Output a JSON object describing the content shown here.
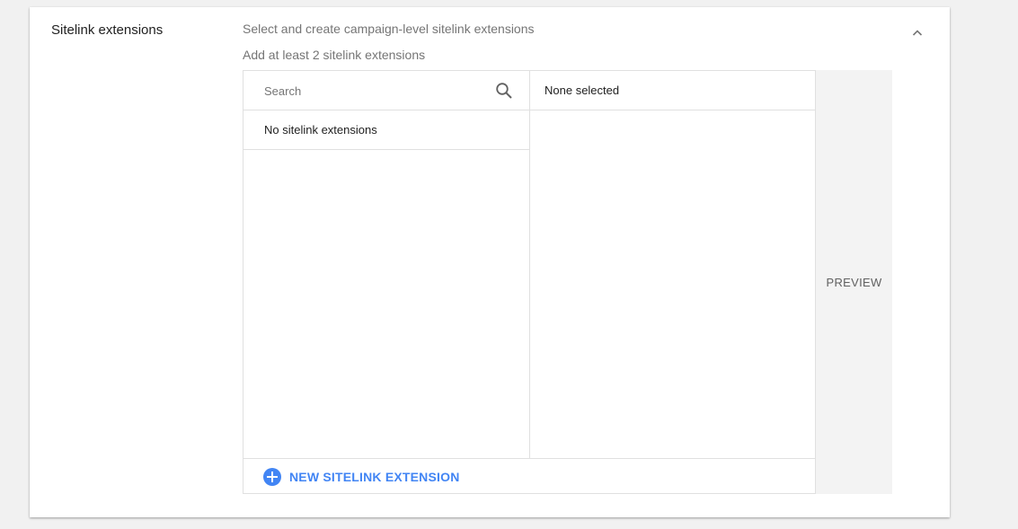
{
  "section": {
    "title": "Sitelink extensions",
    "subtitle": "Select and create campaign-level sitelink extensions",
    "hint": "Add at least 2 sitelink extensions",
    "collapse_icon": "chevron-up-icon"
  },
  "picker": {
    "search": {
      "placeholder": "Search",
      "value": "",
      "icon": "search-icon"
    },
    "available_empty_text": "No sitelink extensions",
    "selected_header": "None selected",
    "new_button": {
      "label": "NEW SITELINK EXTENSION",
      "icon": "plus-circle-icon"
    }
  },
  "preview": {
    "label": "PREVIEW"
  },
  "colors": {
    "accent": "#4285f4",
    "text_primary": "#212121",
    "text_secondary": "#757575",
    "border": "#e0e0e0",
    "preview_bg": "#f3f3f3"
  }
}
